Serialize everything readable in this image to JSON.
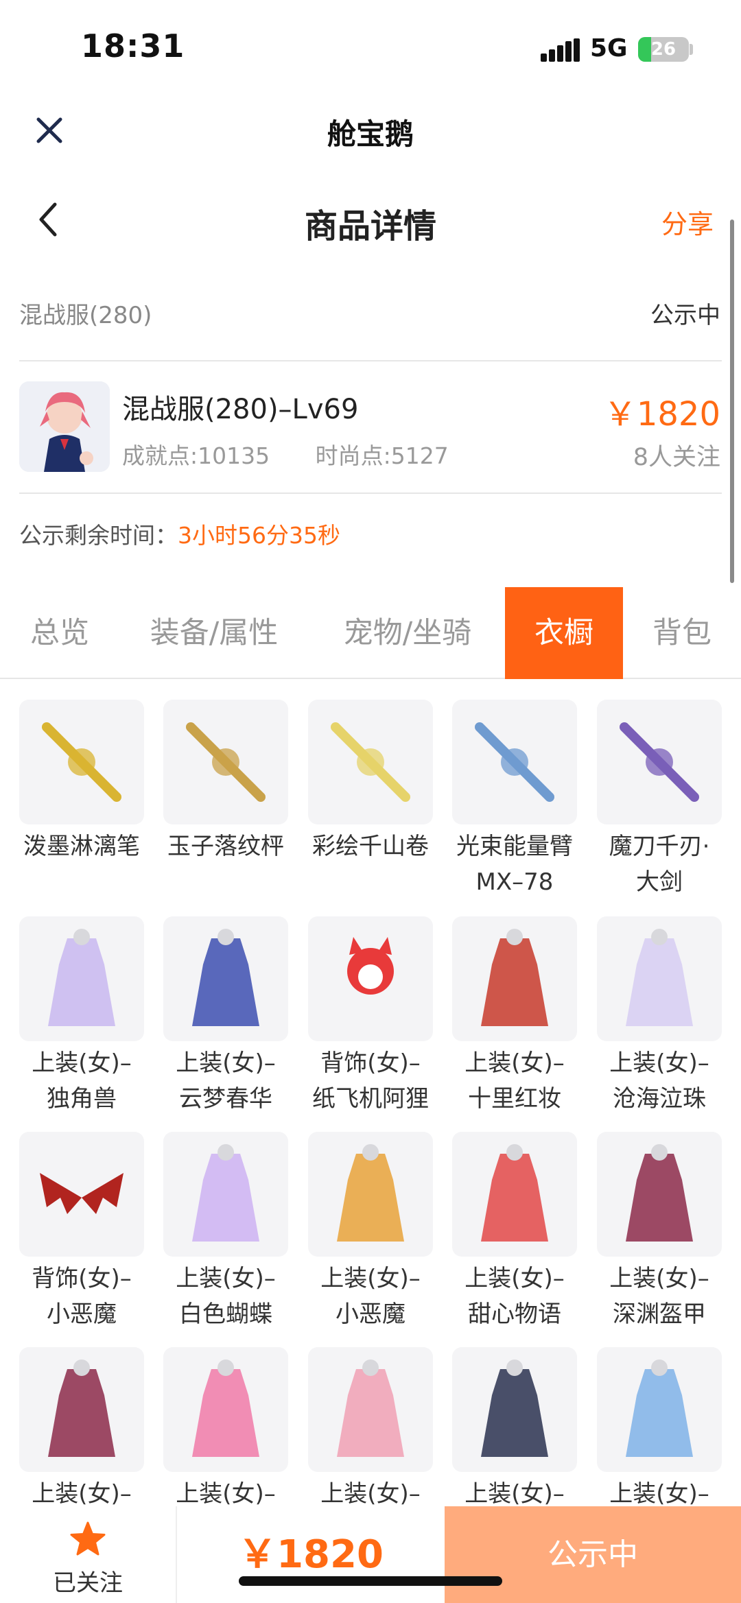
{
  "status_bar": {
    "time": "18:31",
    "network": "5G",
    "battery": "26"
  },
  "mini_app": {
    "title": "舱宝鹅"
  },
  "header": {
    "title": "商品详情",
    "share_label": "分享"
  },
  "server": {
    "name": "混战服(280)",
    "status": "公示中"
  },
  "product": {
    "name": "混战服(280)–Lv69",
    "achievement": "成就点:10135",
    "fashion": "时尚点:5127",
    "price": "￥1820",
    "followers": "8人关注"
  },
  "timer": {
    "label": "公示剩余时间：",
    "value": "3小时56分35秒"
  },
  "tabs": [
    {
      "label": "总览",
      "active": false
    },
    {
      "label": "装备/属性",
      "active": false
    },
    {
      "label": "宠物/坐骑",
      "active": false
    },
    {
      "label": "衣橱",
      "active": true
    },
    {
      "label": "背包",
      "active": false
    }
  ],
  "wardrobe": [
    {
      "line1": "泼墨淋漓笔",
      "line2": "",
      "icon": "brush-icon",
      "color": "#d9b432"
    },
    {
      "line1": "玉子落纹枰",
      "line2": "",
      "icon": "go-board-icon",
      "color": "#c9a24a"
    },
    {
      "line1": "彩绘千山卷",
      "line2": "",
      "icon": "scroll-icon",
      "color": "#e6d36a"
    },
    {
      "line1": "光束能量臂",
      "line2": "MX–78",
      "icon": "arm-cannon-icon",
      "color": "#6f9bd0"
    },
    {
      "line1": "魔刀千刃·",
      "line2": "大剑",
      "icon": "sword-icon",
      "color": "#7a5fb8"
    },
    {
      "line1": "上装(女)–",
      "line2": "独角兽",
      "icon": "unicorn-outfit-icon",
      "color": "#c8b7f0"
    },
    {
      "line1": "上装(女)–",
      "line2": "云梦春华",
      "icon": "blue-dress-icon",
      "color": "#3d4fb0"
    },
    {
      "line1": "背饰(女)–",
      "line2": "纸飞机阿狸",
      "icon": "fox-icon",
      "color": "#e83a3a"
    },
    {
      "line1": "上装(女)–",
      "line2": "十里红妆",
      "icon": "red-robe-icon",
      "color": "#c7392c"
    },
    {
      "line1": "上装(女)–",
      "line2": "沧海泣珠",
      "icon": "pearl-dress-icon",
      "color": "#d6ccf2"
    },
    {
      "line1": "背饰(女)–",
      "line2": "小恶魔",
      "icon": "devil-wings-icon",
      "color": "#b1241f"
    },
    {
      "line1": "上装(女)–",
      "line2": "白色蝴蝶",
      "icon": "butterfly-dress-icon",
      "color": "#cdb1f2"
    },
    {
      "line1": "上装(女)–",
      "line2": "小恶魔",
      "icon": "devil-outfit-icon",
      "color": "#e8a23a"
    },
    {
      "line1": "上装(女)–",
      "line2": "甜心物语",
      "icon": "heart-dress-icon",
      "color": "#e24848"
    },
    {
      "line1": "上装(女)–",
      "line2": "深渊盔甲",
      "icon": "abyss-armor-icon",
      "color": "#8c2a4a"
    },
    {
      "line1": "上装(女)–",
      "line2": "",
      "icon": "dark-armor-icon",
      "color": "#8c2a4a"
    },
    {
      "line1": "上装(女)–",
      "line2": "",
      "icon": "pink-dress-icon",
      "color": "#f07aa8"
    },
    {
      "line1": "上装(女)–",
      "line2": "",
      "icon": "ballgown-icon",
      "color": "#f0a0b4"
    },
    {
      "line1": "上装(女)–",
      "line2": "",
      "icon": "uniform-icon",
      "color": "#2a3150"
    },
    {
      "line1": "上装(女)–",
      "line2": "",
      "icon": "lace-dress-icon",
      "color": "#7fb2e8"
    }
  ],
  "bottom": {
    "follow_label": "已关注",
    "price": "￥1820",
    "action_label": "公示中"
  },
  "colors": {
    "accent": "#ff6214",
    "price": "#ff6a13",
    "action_bg": "#ffab7d"
  }
}
